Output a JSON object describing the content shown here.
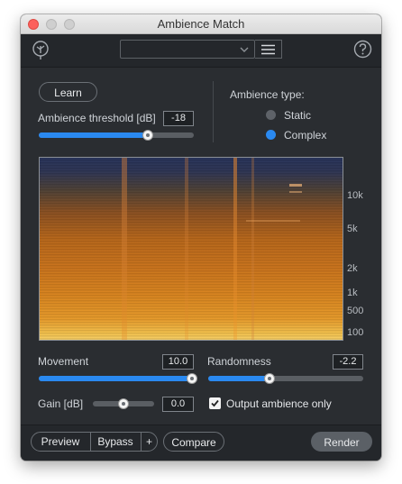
{
  "window": {
    "title": "Ambience Match"
  },
  "toolbar": {
    "logo_icon": "plant-logo-icon",
    "help_icon": "help-icon",
    "preset_value": "",
    "menu_icon": "hamburger-menu-icon"
  },
  "learn": {
    "label": "Learn"
  },
  "threshold": {
    "label": "Ambience threshold [dB]",
    "value": "-18",
    "position_fraction": 0.7
  },
  "ambience_type": {
    "label": "Ambience type:",
    "options": [
      "Static",
      "Complex"
    ],
    "selected": "Complex"
  },
  "spectrogram": {
    "freq_labels": [
      "10k",
      "5k",
      "2k",
      "1k",
      "500",
      "100"
    ],
    "colors": {
      "low": "#27335a",
      "mid": "#c9731c",
      "high": "#f6d06a"
    }
  },
  "movement": {
    "label": "Movement",
    "value": "10.0",
    "position_fraction": 1.0
  },
  "randomness": {
    "label": "Randomness",
    "value": "-2.2",
    "position_fraction": 0.39
  },
  "gain": {
    "label": "Gain [dB]",
    "value": "0.0",
    "position_fraction": 0.5
  },
  "output_only": {
    "label": "Output ambience only",
    "checked": true
  },
  "bottom": {
    "preview": "Preview",
    "bypass": "Bypass",
    "plus": "+",
    "compare": "Compare",
    "render": "Render"
  },
  "colors": {
    "accent": "#2a89f0",
    "panel": "#2a2d31",
    "text": "#cfd3d8"
  }
}
